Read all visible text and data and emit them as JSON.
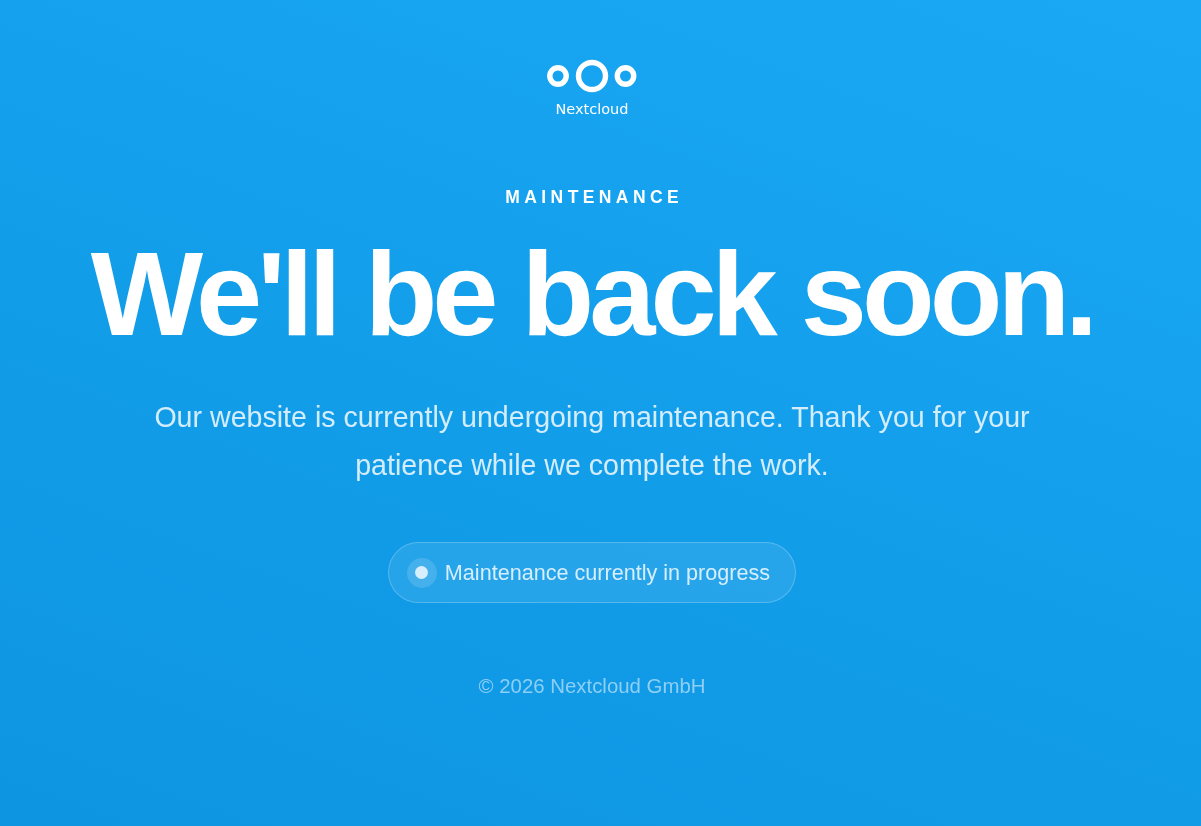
{
  "brand": {
    "name": "Nextcloud"
  },
  "eyebrow": "MAINTENANCE",
  "headline": "We'll be back soon.",
  "message": "Our website is currently undergoing maintenance. Thank you for your patience while we complete the work.",
  "status": {
    "label": "Maintenance currently in progress"
  },
  "footer": {
    "copyright": "© 2026 Nextcloud GmbH"
  }
}
